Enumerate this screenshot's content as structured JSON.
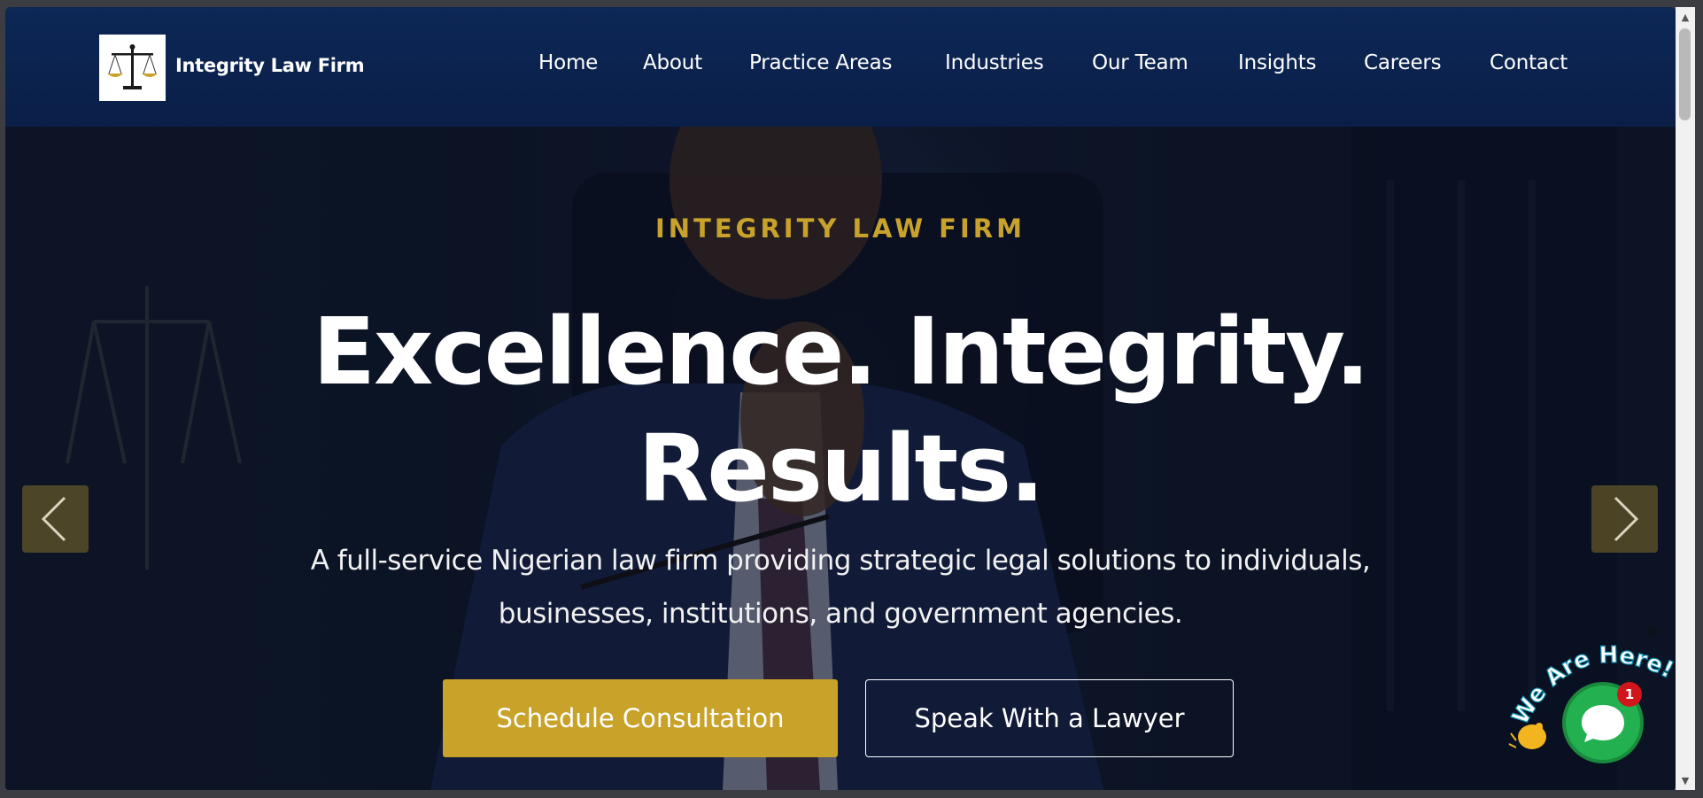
{
  "brand": {
    "name": "Integrity Law Firm",
    "logo_icon": "scales-of-justice-icon"
  },
  "nav": {
    "items": [
      {
        "label": "Home"
      },
      {
        "label": "About"
      },
      {
        "label": "Practice Areas"
      },
      {
        "label": "Industries"
      },
      {
        "label": "Our Team"
      },
      {
        "label": "Insights"
      },
      {
        "label": "Careers"
      },
      {
        "label": "Contact"
      }
    ]
  },
  "hero": {
    "kicker": "INTEGRITY LAW FIRM",
    "headline_line1": "Excellence. Integrity.",
    "headline_line2": "Results.",
    "subtext_line1": "A full-service Nigerian law firm providing strategic legal solutions to individuals,",
    "subtext_line2": "businesses, institutions, and government agencies.",
    "primary_button": "Schedule Consultation",
    "secondary_button": "Speak With a Lawyer",
    "prev_icon": "chevron-left-icon",
    "next_icon": "chevron-right-icon"
  },
  "chat": {
    "tagline": "We Are Here!",
    "badge_count": "1",
    "close_label": "×",
    "icon": "chat-bubble-icon",
    "wave_icon": "waving-hand-icon"
  },
  "colors": {
    "header_bg": "#0b2350",
    "accent_gold": "#c9a22a",
    "chat_green": "#23b050",
    "badge_red": "#d0161c"
  }
}
